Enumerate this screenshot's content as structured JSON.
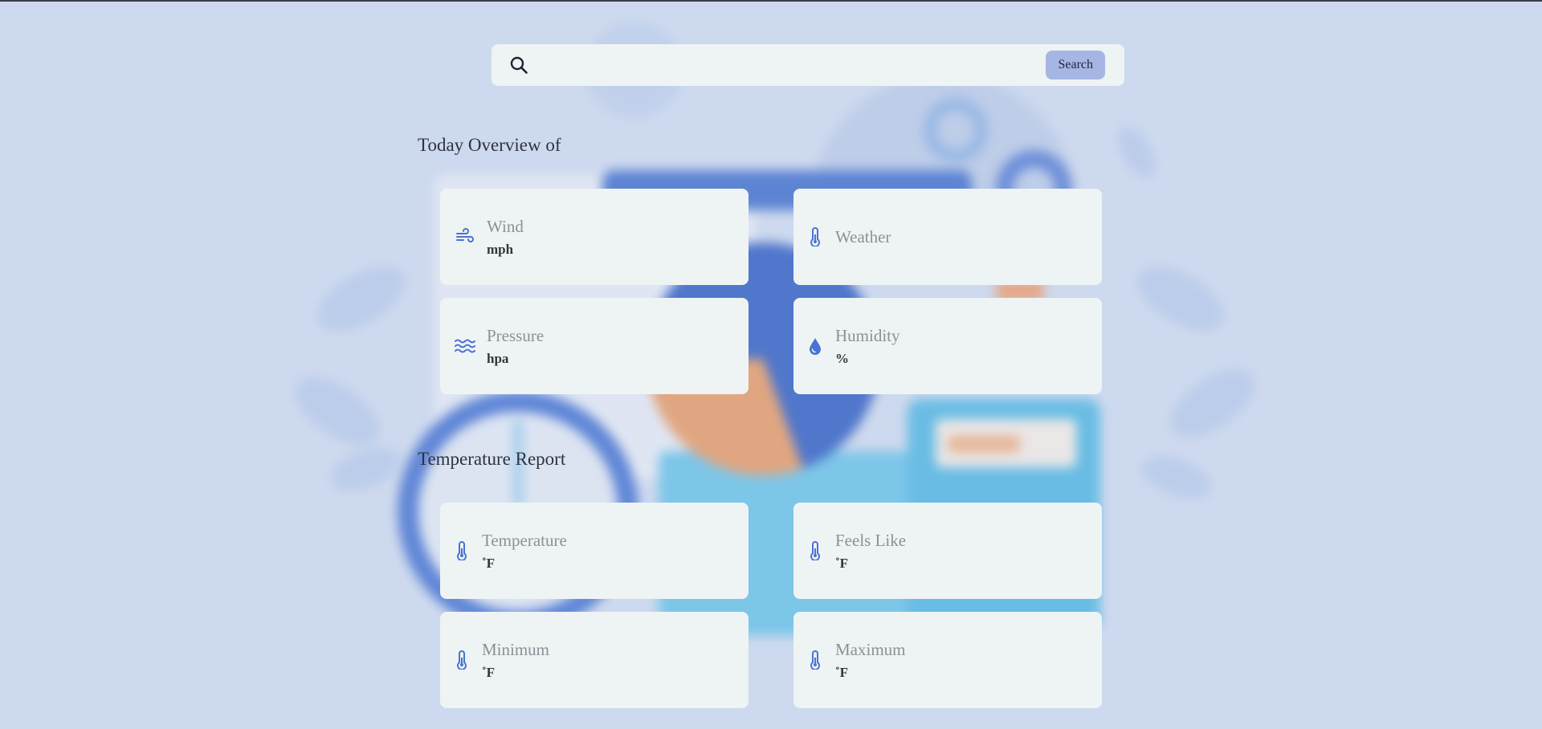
{
  "colors": {
    "page_background": "#cdd9ee",
    "card_background": "#eef3f4",
    "icon_accent": "#4a72d4",
    "search_button": "#a6b6e4",
    "label_text": "#8d9097",
    "value_text": "#33353c"
  },
  "search": {
    "icon": "search-icon",
    "input_value": "",
    "placeholder": "",
    "button_label": "Search"
  },
  "overview": {
    "title": "Today Overview of",
    "cards": [
      {
        "icon": "wind-icon",
        "label": "Wind",
        "value": "mph"
      },
      {
        "icon": "thermometer-icon",
        "label": "Weather",
        "value": ""
      },
      {
        "icon": "waves-icon",
        "label": "Pressure",
        "value": "hpa"
      },
      {
        "icon": "droplet-icon",
        "label": "Humidity",
        "value": "%"
      }
    ]
  },
  "temperature_report": {
    "title": "Temperature Report",
    "cards": [
      {
        "icon": "thermometer-icon",
        "label": "Temperature",
        "value": "˚F"
      },
      {
        "icon": "thermometer-icon",
        "label": "Feels Like",
        "value": "˚F"
      },
      {
        "icon": "thermometer-icon",
        "label": "Minimum",
        "value": "˚F"
      },
      {
        "icon": "thermometer-icon",
        "label": "Maximum",
        "value": "˚F"
      }
    ]
  }
}
